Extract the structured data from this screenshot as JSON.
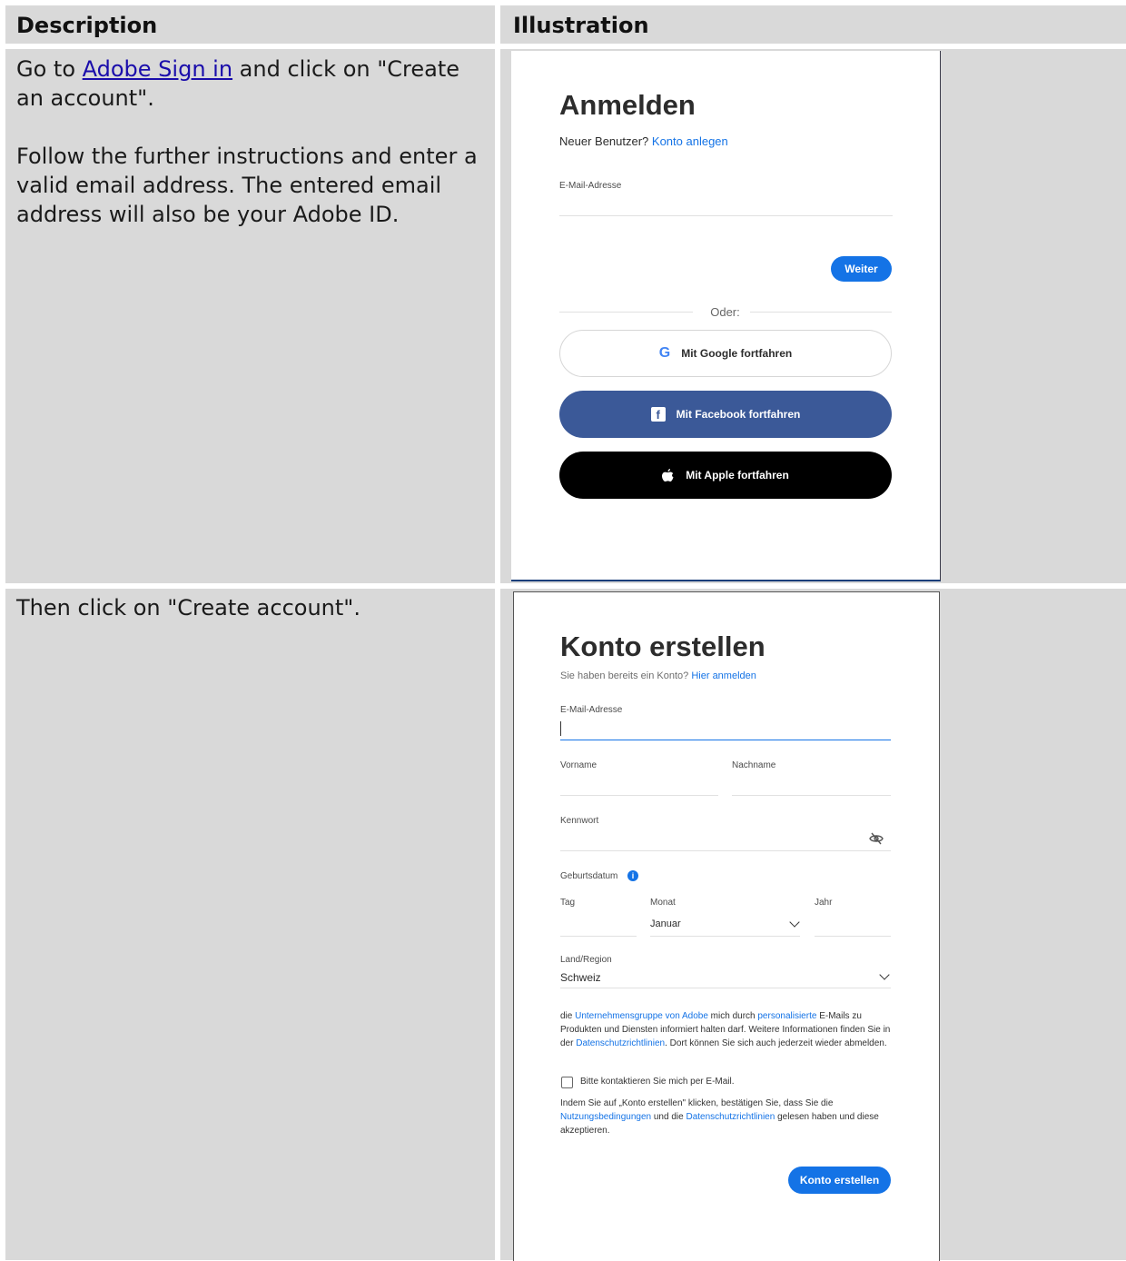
{
  "table": {
    "header_description": "Description",
    "header_illustration": "Illustration",
    "row1": {
      "text_before_link": "Go to ",
      "link_text": "Adobe Sign in",
      "text_after_link": " and click on \"Create an account\".",
      "paragraph2": "Follow the further instructions and enter a valid email address. The entered email address will also be your Adobe ID."
    },
    "row2": {
      "text": "Then click on \"Create account\"."
    }
  },
  "signin": {
    "title": "Anmelden",
    "new_user_prefix": "Neuer Benutzer?",
    "create_account_link": "Konto anlegen",
    "email_label": "E-Mail-Adresse",
    "continue_button": "Weiter",
    "or_text": "Oder:",
    "google_button": "Mit Google fortfahren",
    "facebook_button": "Mit Facebook fortfahren",
    "apple_button": "Mit Apple fortfahren"
  },
  "signup": {
    "title": "Konto erstellen",
    "have_account_prefix": "Sie haben bereits ein Konto?",
    "signin_link": "Hier anmelden",
    "email_label": "E-Mail-Adresse",
    "firstname_label": "Vorname",
    "lastname_label": "Nachname",
    "password_label": "Kennwort",
    "birthdate_label": "Geburtsdatum",
    "day_label": "Tag",
    "month_label": "Monat",
    "month_value": "Januar",
    "year_label": "Jahr",
    "country_label": "Land/Region",
    "country_value": "Schweiz",
    "consent_p1": "die ",
    "consent_link1": "Unternehmensgruppe von Adobe",
    "consent_p2": " mich durch ",
    "consent_link2": "personalisierte",
    "consent_p3": " E-Mails zu Produkten und Diensten informiert halten darf. Weitere Informationen finden Sie in der ",
    "consent_link3": "Datenschutzrichtlinien",
    "consent_p4": ". Dort können Sie sich auch jederzeit wieder abmelden.",
    "checkbox_label": "Bitte kontaktieren Sie mich per E-Mail.",
    "terms_p1": "Indem Sie auf „Konto erstellen\" klicken, bestätigen Sie, dass Sie die ",
    "terms_link1": "Nutzungsbedingungen",
    "terms_p2": " und die ",
    "terms_link2": "Datenschutzrichtlinien",
    "terms_p3": " gelesen haben und diese akzeptieren.",
    "create_button": "Konto erstellen"
  },
  "colors": {
    "adobe_blue": "#1473e6",
    "facebook_blue": "#3b5998",
    "apple_black": "#000000",
    "table_gray": "#d9d9d9"
  }
}
